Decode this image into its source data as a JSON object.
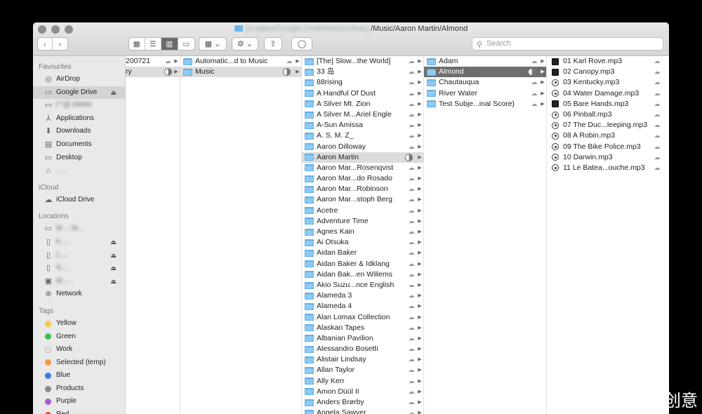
{
  "window": {
    "title_blurred": "Dropbox/Google Drive/Music/Library",
    "title_path": "/Music/Aaron Martin/Almond"
  },
  "toolbar": {
    "search_placeholder": "Search"
  },
  "sidebar": {
    "favourites_heading": "Favourites",
    "favourites": [
      {
        "label": "AirDrop",
        "icon": "airdrop-icon"
      },
      {
        "label": "Google Drive",
        "icon": "drive-icon"
      },
      {
        "label": "I\"\"@ #####",
        "icon": "folder-icon"
      },
      {
        "label": "Applications",
        "icon": "applications-icon"
      },
      {
        "label": "Downloads",
        "icon": "downloads-icon"
      },
      {
        "label": "Documents",
        "icon": "documents-icon"
      },
      {
        "label": "Desktop",
        "icon": "desktop-icon"
      },
      {
        "label": "….",
        "icon": "home-icon"
      }
    ],
    "icloud_heading": "iCloud",
    "icloud": [
      {
        "label": "iCloud Drive",
        "icon": "cloud-icon"
      }
    ],
    "locations_heading": "Locations",
    "locations": [
      {
        "label": "M ... M...",
        "icon": "computer-icon"
      },
      {
        "label": "#......",
        "icon": "disk-icon"
      },
      {
        "label": "L....",
        "icon": "disk-icon"
      },
      {
        "label": "S....",
        "icon": "disk-icon"
      },
      {
        "label": "M.....",
        "icon": "disk-icon"
      },
      {
        "label": "Network",
        "icon": "network-icon"
      }
    ],
    "tags_heading": "Tags",
    "tags": [
      {
        "label": "Yellow",
        "color": "#f5c944"
      },
      {
        "label": "Green",
        "color": "#3dbf4f"
      },
      {
        "label": "Work",
        "color": "#e3e3e3"
      },
      {
        "label": "Selected (temp)",
        "color": "#f29a3d"
      },
      {
        "label": "Blue",
        "color": "#3b79e0"
      },
      {
        "label": "Products",
        "color": "#8a8a8a"
      },
      {
        "label": "Purple",
        "color": "#a55cd4"
      },
      {
        "label": "Red",
        "color": "#e8453c"
      }
    ]
  },
  "columns": {
    "col1": [
      {
        "name": "200721"
      },
      {
        "name": "ry"
      }
    ],
    "col2": [
      {
        "name": "Automatic...d to Music"
      },
      {
        "name": "Music"
      }
    ],
    "col3": [
      "[The] Slow...the World]",
      "33 岛",
      "88rising",
      "A Handful Of Dust",
      "A Silver Mt. Zion",
      "A Silver M...Ariel Engle",
      "A-Sun Amissa",
      "A. S. M. Z_",
      "Aaron Dilloway",
      "Aaron Martin",
      "Aaron Mar...Rosenqvist",
      "Aaron Mar...do Rosado",
      "Aaron Mar...Robinson",
      "Aaron Mar...stoph Berg",
      "Acetre",
      "Adventure Time",
      "Agnes Kain",
      "Ai Otsuka",
      "Aidan Baker",
      "Aidan Baker & Idklang",
      "Aidan Bak...en Willems",
      "Akio Suzu...nce English",
      "Alameda 3",
      "Alameda 4",
      "Alan Lomax Collection",
      "Alaskan Tapes",
      "Albanian Pavilion",
      "Alessandro Bosetti",
      "Alistair Lindsay",
      "Allan Taylor",
      "Ally Kerr",
      "Amon Düül II",
      "Anders Brørby",
      "Angela Sawyer"
    ],
    "col4": [
      "Adam",
      "Almond",
      "Chautauqua",
      "River Water",
      "Test Subje...inal Score)"
    ],
    "col5": [
      "01 Karl Rove.mp3",
      "02 Canopy.mp3",
      "03 Kentucky.mp3",
      "04 Water Damage.mp3",
      "05 Bare Hands.mp3",
      "06 Pinball.mp3",
      "07 The Duc...leeping.mp3",
      "08 A Robin.mp3",
      "09 The Bike Police.mp3",
      "10 Darwin.mp3",
      "11 Le Batea...ouche.mp3"
    ]
  },
  "watermark": "创意"
}
